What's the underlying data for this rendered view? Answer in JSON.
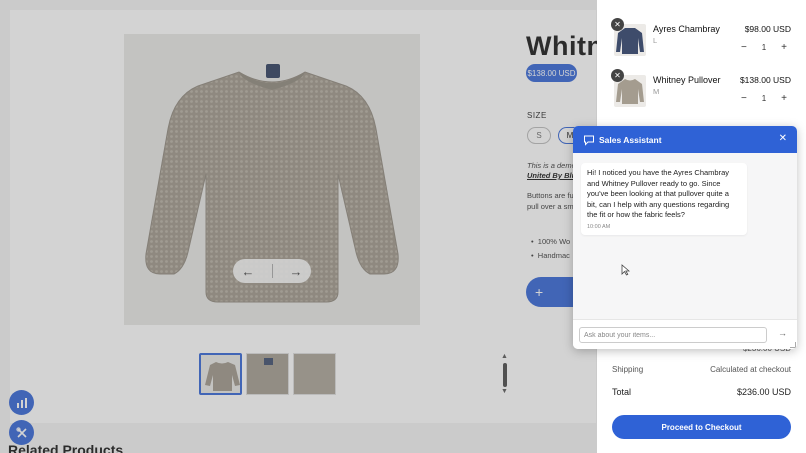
{
  "product": {
    "title": "Whitn",
    "price": "$138.00 USD",
    "size_label": "SIZE",
    "sizes": [
      "S",
      "M"
    ],
    "selected_size": "M",
    "desc_intro": "This is a demo",
    "desc_link": "United By Blu",
    "desc_body": "Buttons are fu the pull over a small.",
    "bullets": [
      "100% Wo",
      "Handmac"
    ],
    "add_symbol": "+",
    "nav_prev": "←",
    "nav_next": "→"
  },
  "related_heading": "Related Products",
  "cart": {
    "items": [
      {
        "name": "Ayres Chambray",
        "variant": "L",
        "price": "$98.00 USD",
        "qty": "1",
        "remove": "✕",
        "minus": "−",
        "plus": "+"
      },
      {
        "name": "Whitney Pullover",
        "variant": "M",
        "price": "$138.00 USD",
        "qty": "1",
        "remove": "✕",
        "minus": "−",
        "plus": "+"
      }
    ],
    "subtotal_value": "$236.00 USD",
    "shipping_label": "Shipping",
    "shipping_value": "Calculated at checkout",
    "total_label": "Total",
    "total_value": "$236.00 USD",
    "checkout_label": "Proceed to Checkout"
  },
  "chat": {
    "title": "Sales Assistant",
    "close": "✕",
    "message": "Hi! I noticed you have the Ayres Chambray and Whitney Pullover ready to go. Since you've been looking at that pullover quite a bit, can I help with any questions regarding the fit or how the fabric feels?",
    "time": "10:00 AM",
    "input_placeholder": "Ask about your items...",
    "send": "→"
  },
  "colors": {
    "accent": "#2f62d6"
  },
  "icons": [
    "chat-bubble-icon",
    "bar-chart-icon",
    "tools-icon",
    "close-icon",
    "arrow-left-icon",
    "arrow-right-icon",
    "send-arrow-icon",
    "cursor-icon"
  ]
}
